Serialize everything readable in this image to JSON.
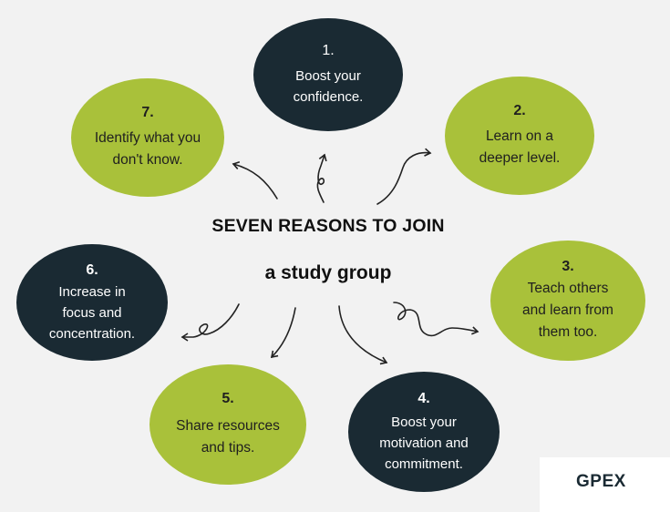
{
  "title": "SEVEN REASONS TO JOIN",
  "subtitle": "a study group",
  "logo": "GPEX",
  "colors": {
    "dark": "#1a2a33",
    "green": "#a9c13a",
    "background": "#f2f2f2"
  },
  "reasons": [
    {
      "number": "1.",
      "lines": [
        "Boost your",
        "confidence."
      ]
    },
    {
      "number": "2.",
      "lines": [
        "Learn on a",
        "deeper level."
      ]
    },
    {
      "number": "3.",
      "lines": [
        "Teach others",
        "and learn from",
        "them too."
      ]
    },
    {
      "number": "4.",
      "lines": [
        "Boost your",
        "motivation and",
        "commitment."
      ]
    },
    {
      "number": "5.",
      "lines": [
        "Share resources",
        "and tips."
      ]
    },
    {
      "number": "6.",
      "lines": [
        "Increase in",
        "focus and",
        "concentration."
      ]
    },
    {
      "number": "7.",
      "lines": [
        "Identify what you",
        "don't know."
      ]
    }
  ]
}
